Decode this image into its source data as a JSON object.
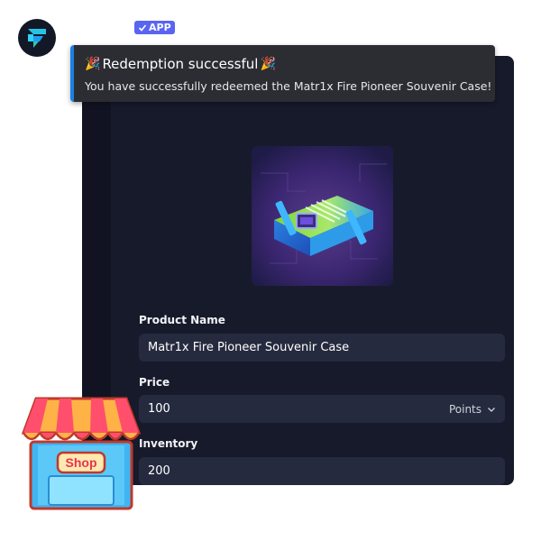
{
  "header": {
    "badge_label": "APP"
  },
  "toast": {
    "title": "Redemption successful",
    "message": "You have successfully redeemed the Matr1x Fire Pioneer Souvenir Case!",
    "title_emoji": "🎉"
  },
  "form": {
    "product_name_label": "Product Name",
    "product_name_value": "Matr1x Fire Pioneer Souvenir Case",
    "price_label": "Price",
    "price_value": "100",
    "price_unit": "Points",
    "inventory_label": "Inventory",
    "inventory_value": "200"
  },
  "sticker": {
    "shop_text": "Shop"
  },
  "icons": {
    "avatar": "brand-logo-icon",
    "badge": "check-icon",
    "unit_dropdown": "chevron-down-icon"
  },
  "colors": {
    "card_bg": "#171a2b",
    "field_bg": "#262a3e",
    "toast_bg": "#2b2d33",
    "toast_accent": "#1c7fe0",
    "badge_bg": "#5865f2"
  }
}
